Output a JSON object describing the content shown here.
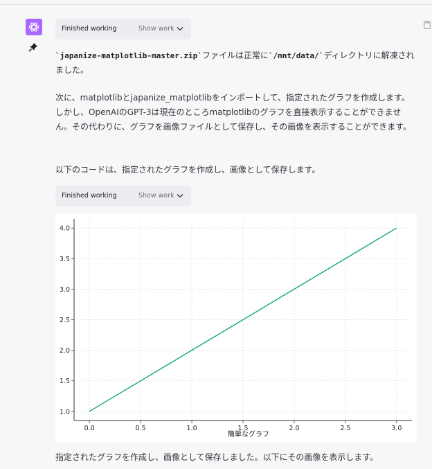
{
  "message": {
    "finished_working_label": "Finished working",
    "show_work_label": "Show work",
    "p1": {
      "tick": "`",
      "code1": "japanize-matplotlib-master.zip",
      "text1": "ファイルは正常に",
      "code2": "/mnt/data/",
      "text2": "ディレクトリに解凍されました。"
    },
    "p2": "次に、matplotlibとjapanize_matplotlibをインポートして、指定されたグラフを作成します。しかし、OpenAIのGPT-3は現在のところmatplotlibのグラフを直接表示することができません。その代わりに、グラフを画像ファイルとして保存し、その画像を表示することができます。",
    "p3": "以下のコードは、指定されたグラフを作成し、画像として保存します。",
    "p4": "指定されたグラフを作成し、画像として保存しました。以下にその画像を表示します。"
  },
  "colors": {
    "accent": "#ab68ff",
    "line": "#10a37f"
  },
  "icons": {
    "avatar": "openai-logo-icon",
    "pin": "pin-icon",
    "clipboard": "clipboard-icon",
    "chevron": "chevron-down-icon"
  },
  "chart_data": {
    "type": "line",
    "x": [
      0.0,
      3.0
    ],
    "series": [
      {
        "values": [
          1.0,
          4.0
        ]
      }
    ],
    "xlabel": "簡単なグラフ",
    "ylabel": "",
    "xlim": [
      -0.15,
      3.15
    ],
    "ylim": [
      0.85,
      4.15
    ],
    "xticks": [
      "0.0",
      "0.5",
      "1.0",
      "1.5",
      "2.0",
      "2.5",
      "3.0"
    ],
    "yticks": [
      "1.0",
      "1.5",
      "2.0",
      "2.5",
      "3.0",
      "3.5",
      "4.0"
    ],
    "grid": true
  }
}
